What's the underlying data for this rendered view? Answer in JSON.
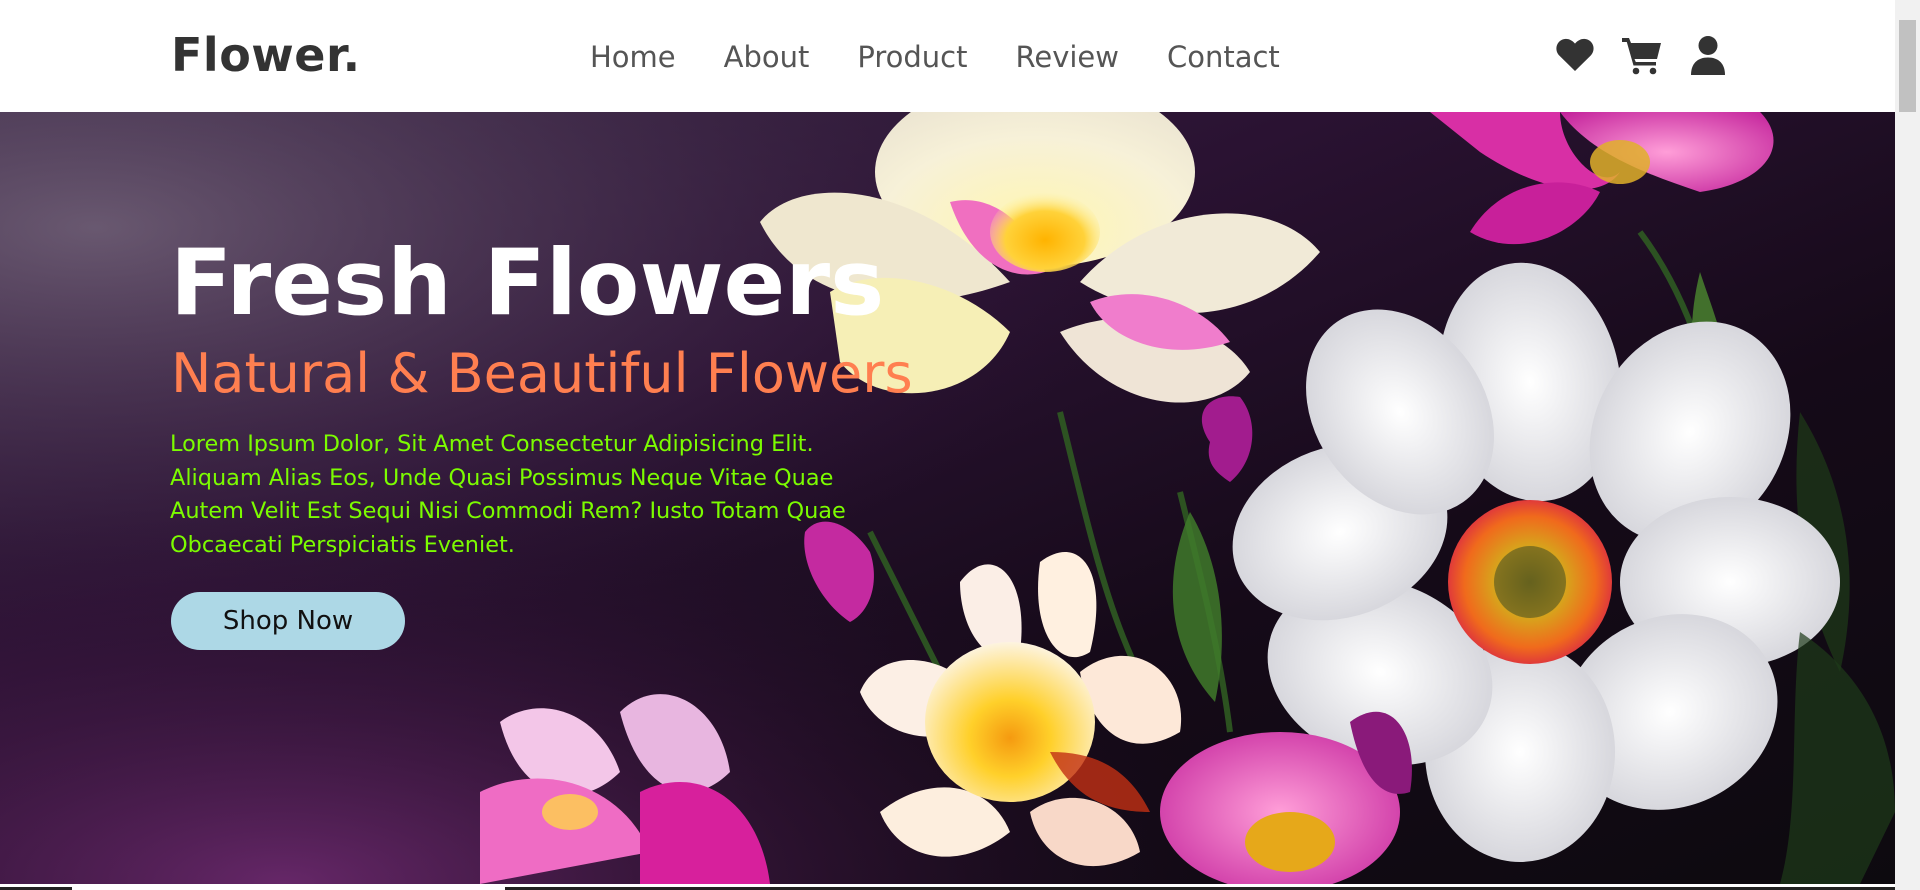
{
  "header": {
    "logo": "Flower.",
    "nav": [
      {
        "label": "Home"
      },
      {
        "label": "About"
      },
      {
        "label": "Product"
      },
      {
        "label": "Review"
      },
      {
        "label": "Contact"
      }
    ],
    "icons": [
      "heart-icon",
      "shopping-cart-icon",
      "user-icon"
    ]
  },
  "hero": {
    "title": "Fresh Flowers",
    "subtitle": "Natural & Beautiful Flowers",
    "description_lines": [
      "Lorem Ipsum Dolor, Sit Amet Consectetur Adipisicing Elit.",
      "Aliquam Alias Eos, Unde Quasi Possimus Neque Vitae Quae",
      "Autem Velit Est Sequi Nisi Commodi Rem? Iusto Totam Quae",
      "Obcaecati Perspiciatis Eveniet."
    ],
    "button_label": "Shop Now"
  },
  "colors": {
    "logo": "#333333",
    "nav_text": "#555555",
    "subtitle": "#ff7f50",
    "description": "#7cfc00",
    "button_bg": "#add8e6",
    "hero_bg": "#1b0f1f"
  }
}
